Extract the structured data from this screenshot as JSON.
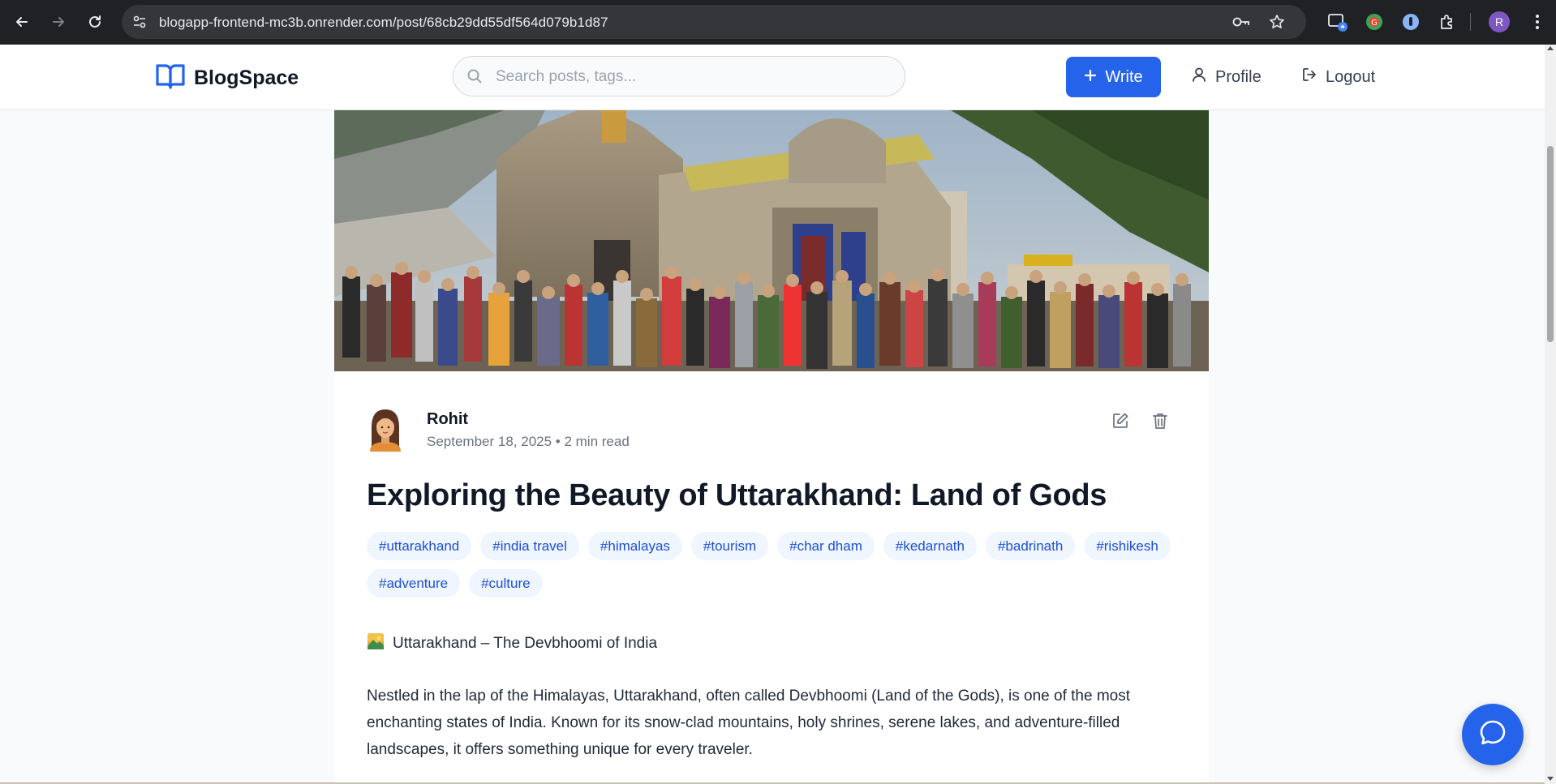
{
  "browser": {
    "url": "blogapp-frontend-mc3b.onrender.com/post/68cb29dd55df564d079b1d87",
    "profile_initial": "R"
  },
  "header": {
    "logo_text": "BlogSpace",
    "search_placeholder": "Search posts, tags...",
    "write_label": "Write",
    "profile_label": "Profile",
    "logout_label": "Logout"
  },
  "post": {
    "author": "Rohit",
    "meta": "September 18, 2025 • 2 min read",
    "title": "Exploring the Beauty of Uttarakhand: Land of Gods",
    "tags": [
      "#uttarakhand",
      "#india travel",
      "#himalayas",
      "#tourism",
      "#char dham",
      "#kedarnath",
      "#badrinath",
      "#rishikesh",
      "#adventure",
      "#culture"
    ],
    "intro": "Uttarakhand – The Devbhoomi of India",
    "paragraph": "Nestled in the lap of the Himalayas, Uttarakhand, often called Devbhoomi (Land of the Gods), is one of the most enchanting states of India. Known for its snow-clad mountains, holy shrines, serene lakes, and adventure-filled landscapes, it offers something unique for every traveler."
  },
  "colors": {
    "accent": "#2563eb",
    "tag_bg": "#eff6ff",
    "tag_text": "#1d4ed8"
  }
}
